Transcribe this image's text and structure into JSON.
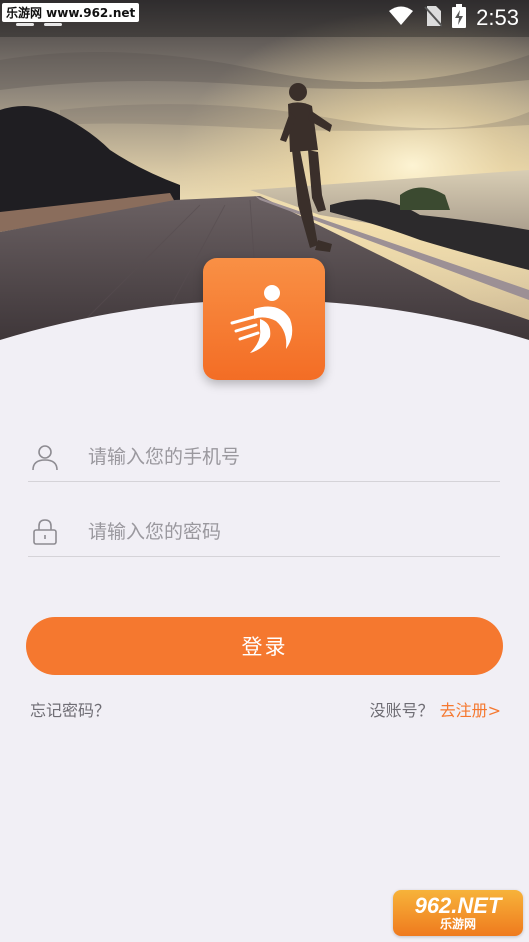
{
  "status_bar": {
    "watermark": "乐游网 www.962.net",
    "time": "2:53"
  },
  "form": {
    "phone_placeholder": "请输入您的手机号",
    "password_placeholder": "请输入您的密码"
  },
  "buttons": {
    "login_label": "登录"
  },
  "links": {
    "forgot_password": "忘记密码？",
    "no_account": "没账号？",
    "register": "去注册>"
  },
  "watermark_bottom": {
    "number": "962.NET",
    "site": "乐游网"
  },
  "colors": {
    "accent": "#f5782f",
    "background": "#f1eff5",
    "divider": "#d5d3d8"
  }
}
